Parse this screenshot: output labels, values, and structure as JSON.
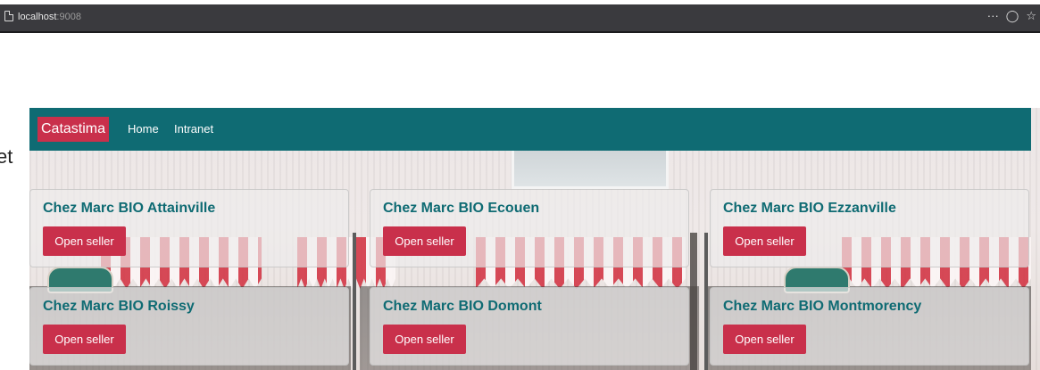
{
  "browser": {
    "url_host": "localhost",
    "url_port": ":9008",
    "icons": [
      "page-icon",
      "more-icon",
      "pocket-icon",
      "star-icon"
    ]
  },
  "page": {
    "cut_text": "et"
  },
  "navbar": {
    "brand": "Catastima",
    "links": [
      "Home",
      "Intranet"
    ],
    "color": "#0f6b73",
    "accent": "#c9304b"
  },
  "sellers": [
    {
      "name": "Chez Marc BIO Attainville",
      "button": "Open seller"
    },
    {
      "name": "Chez Marc BIO Ecouen",
      "button": "Open seller"
    },
    {
      "name": "Chez Marc BIO Ezzanville",
      "button": "Open seller"
    },
    {
      "name": "Chez Marc BIO Roissy",
      "button": "Open seller"
    },
    {
      "name": "Chez Marc BIO Domont",
      "button": "Open seller"
    },
    {
      "name": "Chez Marc BIO Montmorency",
      "button": "Open seller"
    }
  ]
}
